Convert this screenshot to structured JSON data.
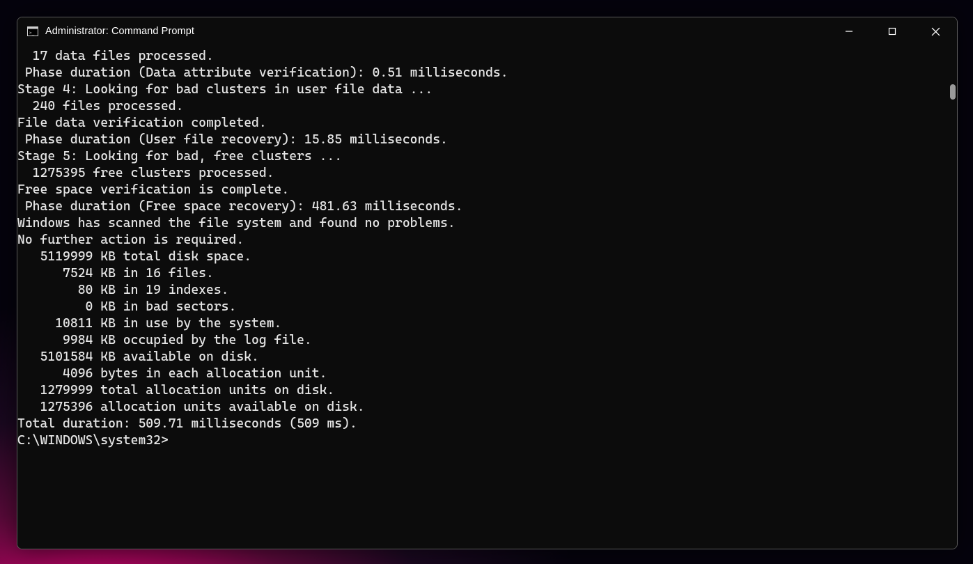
{
  "window": {
    "title": "Administrator: Command Prompt"
  },
  "terminal": {
    "lines": [
      "  17 data files processed.",
      " Phase duration (Data attribute verification): 0.51 milliseconds.",
      "",
      "Stage 4: Looking for bad clusters in user file data ...",
      "  240 files processed.",
      "File data verification completed.",
      " Phase duration (User file recovery): 15.85 milliseconds.",
      "",
      "Stage 5: Looking for bad, free clusters ...",
      "  1275395 free clusters processed.",
      "Free space verification is complete.",
      " Phase duration (Free space recovery): 481.63 milliseconds.",
      "",
      "Windows has scanned the file system and found no problems.",
      "No further action is required.",
      "",
      "   5119999 KB total disk space.",
      "      7524 KB in 16 files.",
      "        80 KB in 19 indexes.",
      "         0 KB in bad sectors.",
      "     10811 KB in use by the system.",
      "      9984 KB occupied by the log file.",
      "   5101584 KB available on disk.",
      "",
      "      4096 bytes in each allocation unit.",
      "   1279999 total allocation units on disk.",
      "   1275396 allocation units available on disk.",
      "Total duration: 509.71 milliseconds (509 ms).",
      "",
      "C:\\WINDOWS\\system32>"
    ]
  }
}
